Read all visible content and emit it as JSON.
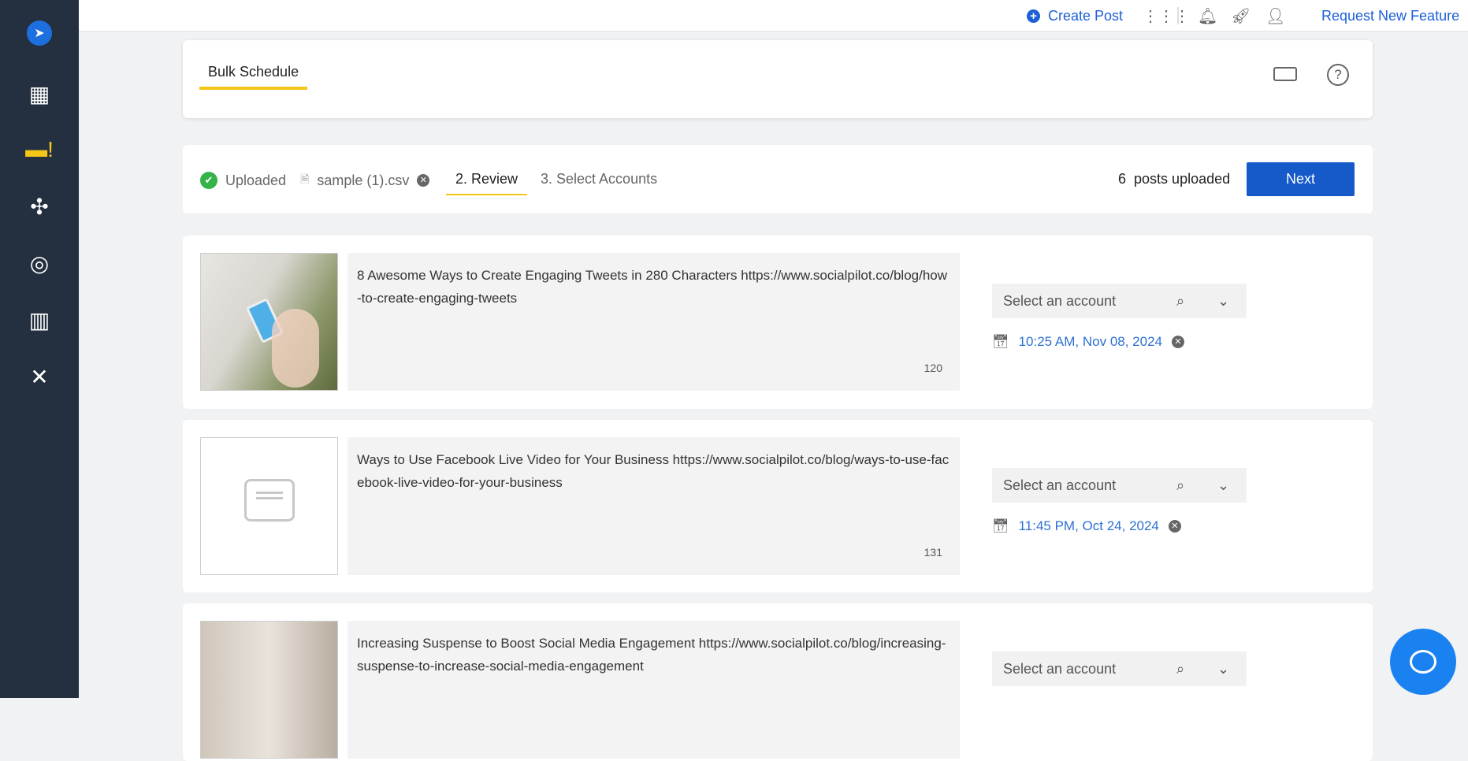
{
  "topbar": {
    "create_post": "Create Post",
    "request_feature": "Request New Feature"
  },
  "header": {
    "tab": "Bulk Schedule"
  },
  "steps": {
    "uploaded": "Uploaded",
    "file": "sample (1).csv",
    "review": "2. Review",
    "select_accounts": "3. Select Accounts",
    "count": "6",
    "posts_uploaded": "posts uploaded",
    "next": "Next"
  },
  "posts": [
    {
      "text": "8 Awesome Ways to Create Engaging Tweets in 280 Characters https://www.socialpilot.co/blog/how-to-create-engaging-tweets",
      "count": "120",
      "account_placeholder": "Select an account",
      "date": "10:25 AM, Nov 08, 2024"
    },
    {
      "text": "Ways to Use Facebook Live Video for Your Business https://www.socialpilot.co/blog/ways-to-use-facebook-live-video-for-your-business",
      "count": "131",
      "account_placeholder": "Select an account",
      "date": "11:45 PM, Oct 24, 2024"
    },
    {
      "text": "Increasing Suspense to Boost Social Media Engagement https://www.socialpilot.co/blog/increasing-suspense-to-increase-social-media-engagement",
      "account_placeholder": "Select an account"
    }
  ]
}
